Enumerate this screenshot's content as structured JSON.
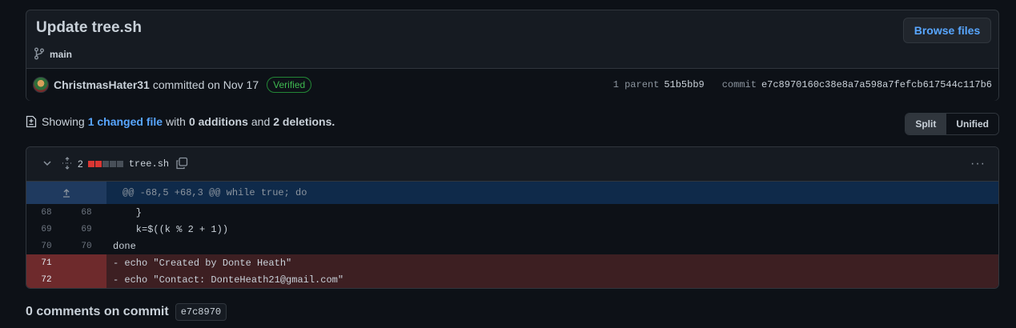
{
  "commit": {
    "title": "Update tree.sh",
    "browse_files": "Browse files",
    "branch": "main",
    "author": "ChristmasHater31",
    "committed_text": "committed on Nov 17",
    "verified": "Verified",
    "parent_label": "1 parent",
    "parent_sha": "51b5bb9",
    "commit_label": "commit",
    "commit_sha": "e7c8970160c38e8a7a598a7fefcb617544c117b6"
  },
  "summary": {
    "showing": "Showing",
    "changed_files": "1 changed file",
    "with": "with",
    "additions": "0 additions",
    "and": "and",
    "deletions": "2 deletions."
  },
  "view_toggle": {
    "split": "Split",
    "unified": "Unified"
  },
  "file": {
    "changes_count": "2",
    "name": "tree.sh",
    "diffstat": [
      "del",
      "del",
      "neu",
      "neu",
      "neu"
    ],
    "hunk_header": "@@ -68,5 +68,3 @@ while true; do"
  },
  "lines": [
    {
      "old": "68",
      "new": "68",
      "type": "ctx",
      "text": "    }"
    },
    {
      "old": "69",
      "new": "69",
      "type": "ctx",
      "text": "    k=$((k % 2 + 1))"
    },
    {
      "old": "70",
      "new": "70",
      "type": "ctx",
      "text": "done"
    },
    {
      "old": "71",
      "new": "",
      "type": "del",
      "text": "echo \"Created by Donte Heath\""
    },
    {
      "old": "72",
      "new": "",
      "type": "del",
      "text": "echo \"Contact: DonteHeath21@gmail.com\""
    }
  ],
  "comments": {
    "label": "0 comments on commit",
    "sha": "e7c8970"
  },
  "colors": {
    "background": "#0d1117",
    "accent": "#58a6ff",
    "deletion": "#da3633",
    "verified": "#3fb950"
  }
}
